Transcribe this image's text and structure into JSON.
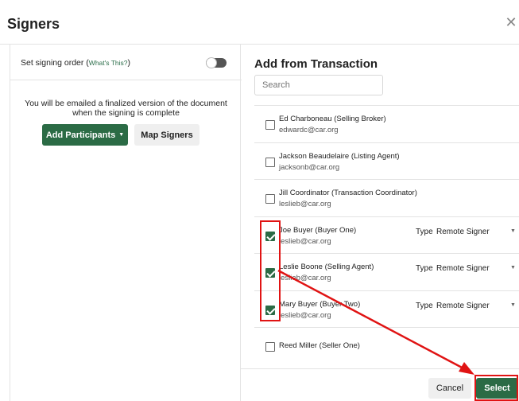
{
  "dialog": {
    "title": "Signers",
    "close_glyph": "✕"
  },
  "left": {
    "order_label": "Set signing order (",
    "whats_this": "What's This?",
    "order_label_close": ")",
    "signing_order_enabled": false,
    "email_note_line1": "You will be emailed a finalized version of the document",
    "email_note_line2": "when the signing is complete",
    "add_participants": "Add Participants",
    "map_signers": "Map Signers"
  },
  "right": {
    "title": "Add from Transaction",
    "search_placeholder": "Search",
    "type_label": "Type",
    "rows": [
      {
        "name": "Ed Charboneau (Selling Broker)",
        "email": "edwardc@car.org",
        "checked": false,
        "type": ""
      },
      {
        "name": "Jackson Beaudelaire (Listing Agent)",
        "email": "jacksonb@car.org",
        "checked": false,
        "type": ""
      },
      {
        "name": "Jill Coordinator (Transaction Coordinator)",
        "email": "leslieb@car.org",
        "checked": false,
        "type": ""
      },
      {
        "name": "Joe Buyer (Buyer One)",
        "email": "leslieb@car.org",
        "checked": true,
        "type": "Remote Signer"
      },
      {
        "name": "Leslie Boone (Selling Agent)",
        "email": "leslieb@car.org",
        "checked": true,
        "type": "Remote Signer"
      },
      {
        "name": "Mary Buyer (Buyer Two)",
        "email": "leslieb@car.org",
        "checked": true,
        "type": "Remote Signer"
      },
      {
        "name": "Reed Miller (Seller One)",
        "email": "",
        "checked": false,
        "type": ""
      }
    ]
  },
  "footer": {
    "cancel": "Cancel",
    "select": "Select"
  },
  "colors": {
    "brand_green": "#2b6b45",
    "annotation_red": "#e01313"
  },
  "icons": {
    "close": "close-icon",
    "dropdown": "caret-down-icon",
    "check": "checkmark-icon"
  }
}
